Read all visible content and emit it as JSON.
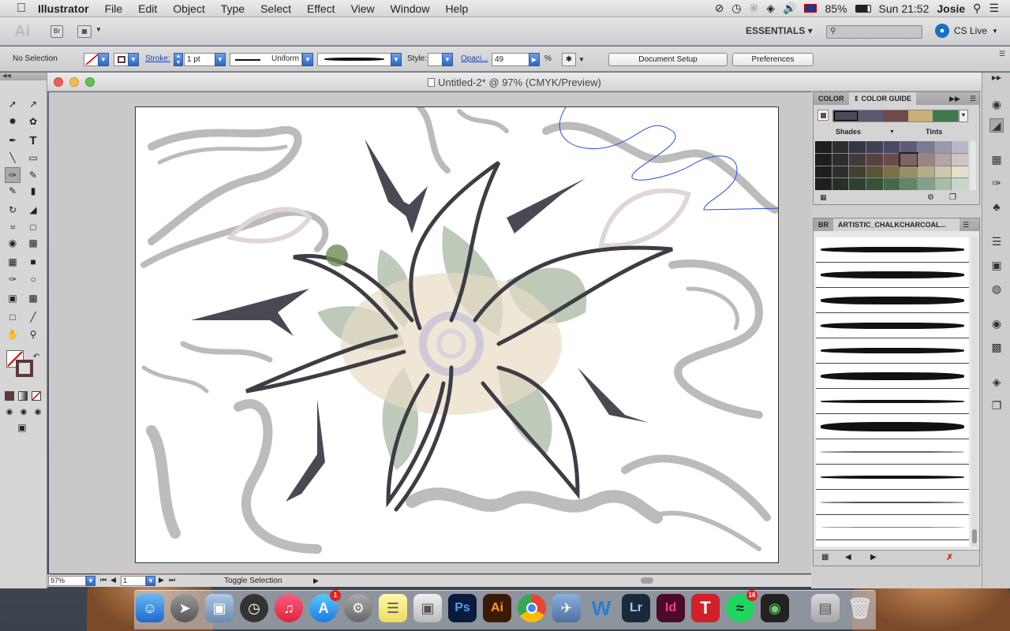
{
  "menubar": {
    "app": "Illustrator",
    "items": [
      "File",
      "Edit",
      "Object",
      "Type",
      "Select",
      "Effect",
      "View",
      "Window",
      "Help"
    ],
    "battery": "85%",
    "clock": "Sun 21:52",
    "user": "Josie"
  },
  "appbar": {
    "logo": "Ai",
    "bridge": "Br",
    "workspace": "ESSENTIALS",
    "search_placeholder": "",
    "cslive": "CS Live"
  },
  "control": {
    "selection": "No Selection",
    "stroke_label": "Stroke:",
    "stroke_value": "1 pt",
    "profile": "Uniform",
    "style_label": "Style:",
    "opacity_label": "Opaci...",
    "opacity_value": "49",
    "percent": "%",
    "doc_setup": "Document Setup",
    "preferences": "Preferences"
  },
  "document": {
    "title": "Untitled-2* @ 97% (CMYK/Preview)",
    "zoom": "97%",
    "page": "1",
    "status_text": "Toggle Selection"
  },
  "color_panel": {
    "tabs": [
      "COLOR",
      "COLOR GUIDE"
    ],
    "shades": "Shades",
    "tints": "Tints",
    "harmony": [
      "#4a4a5a",
      "#5a5a6e",
      "#6e4a4a",
      "#c8b078",
      "#3e7a4e"
    ],
    "grid": [
      [
        "#1e1e1e",
        "#2e2e2e",
        "#353545",
        "#404058",
        "#4a4a66",
        "#5c5c78",
        "#7a7a92",
        "#9a9aae",
        "#b8b8c8"
      ],
      [
        "#1e1e1e",
        "#2e2e2e",
        "#443838",
        "#564040",
        "#6a4a4a",
        "#7e6464",
        "#988484",
        "#b4a4a4",
        "#d0c4c4"
      ],
      [
        "#1e1e1e",
        "#2e2e2e",
        "#444030",
        "#5a5438",
        "#7a7048",
        "#9a8e66",
        "#b6ac88",
        "#d0c8aa",
        "#e4dfcc"
      ],
      [
        "#1e1e1e",
        "#263026",
        "#2e4030",
        "#385238",
        "#446a4a",
        "#628468",
        "#84a08a",
        "#a8bcac",
        "#c8d6ca"
      ]
    ]
  },
  "brush_panel": {
    "tab_short": "BR",
    "title": "ARTISTIC_CHALKCHARCOAL..."
  },
  "dock": {
    "photoshop": "Ps",
    "illustrator": "Ai",
    "word": "W",
    "lightroom": "Lr",
    "indesign": "Id",
    "text_app": "T",
    "appstore_badge": "1",
    "spotify_badge": "16"
  }
}
